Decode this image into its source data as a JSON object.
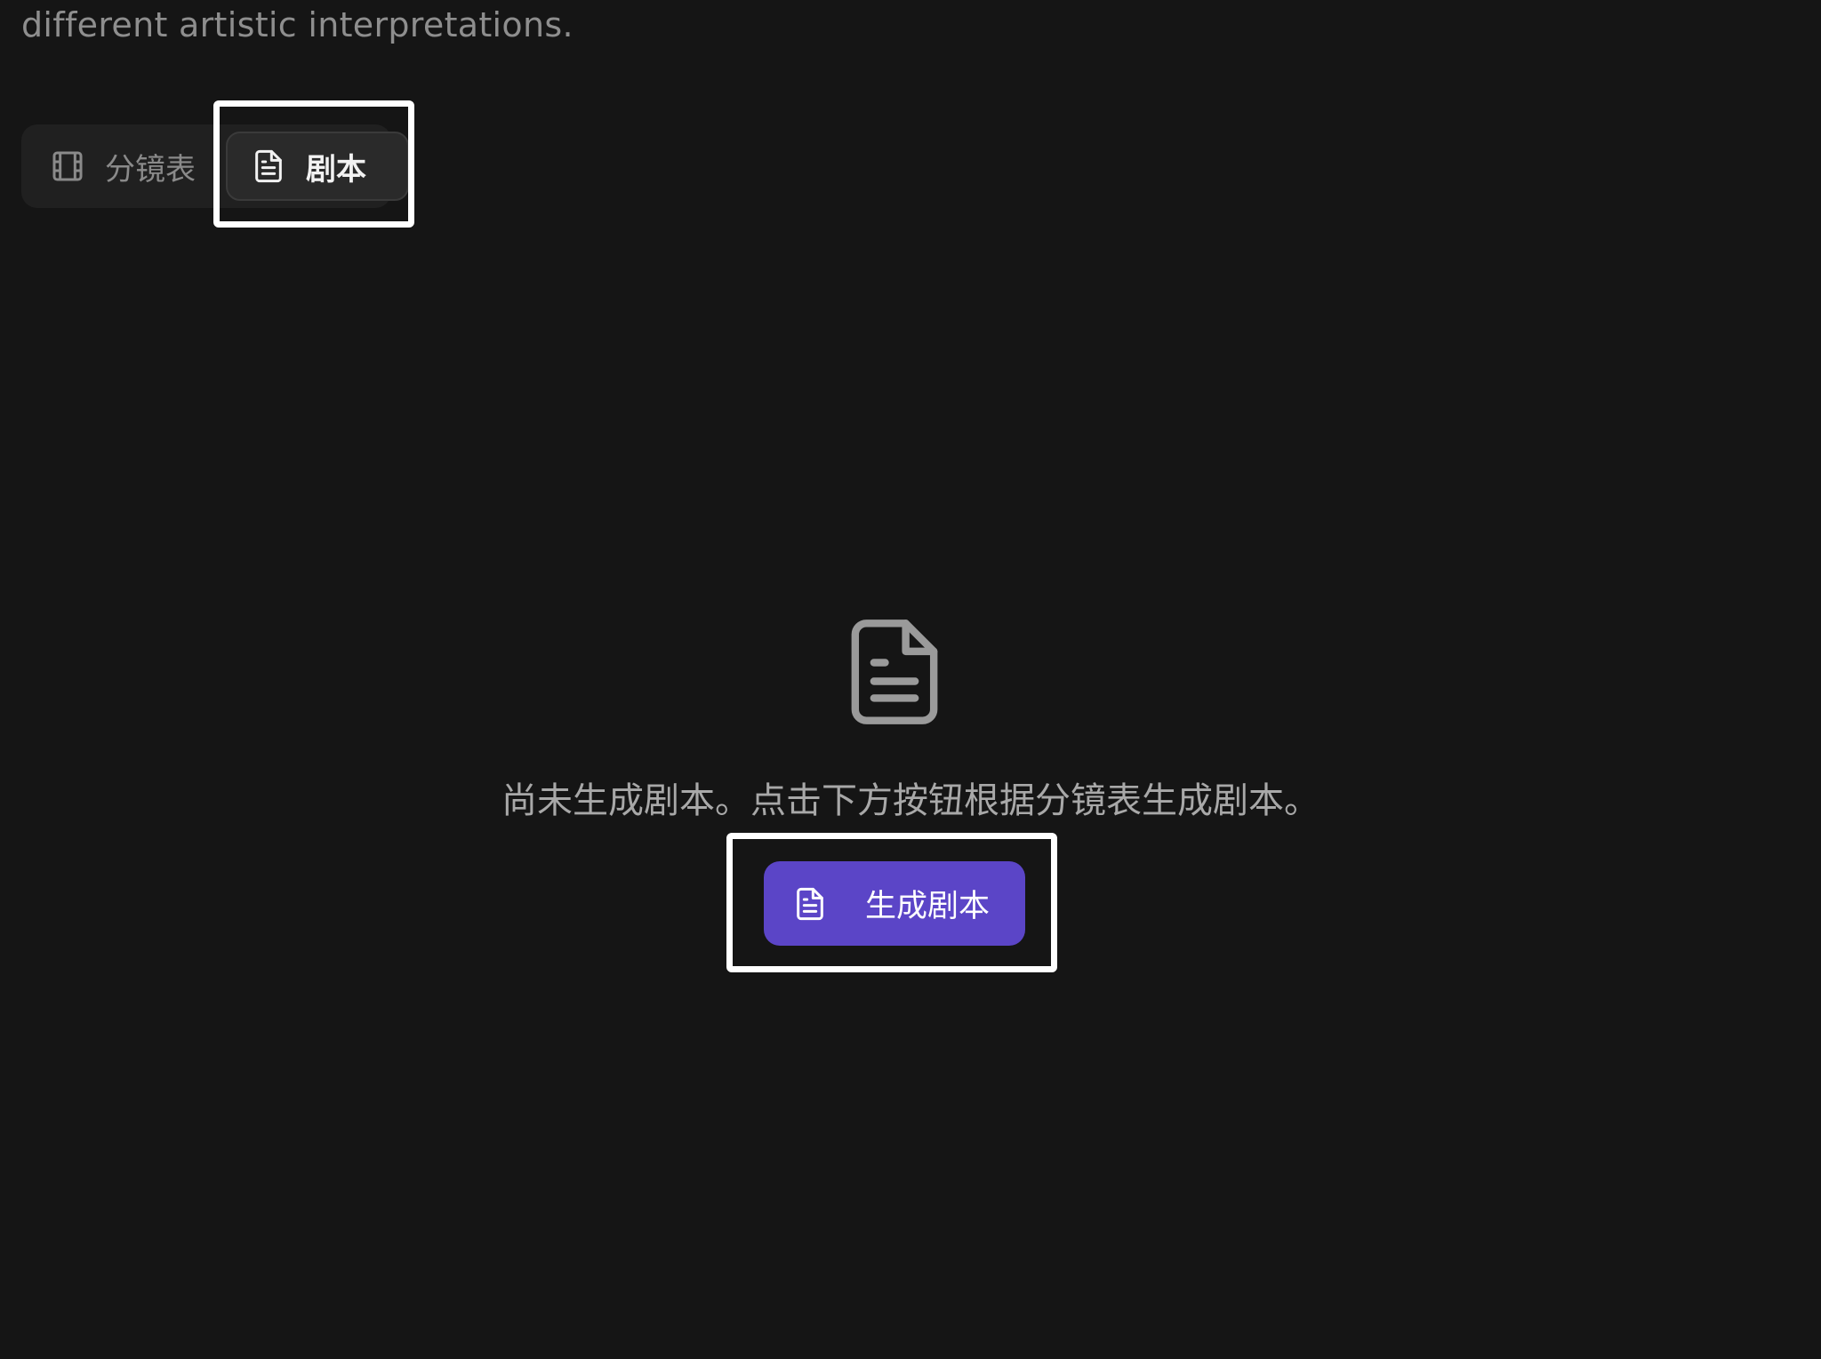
{
  "header": {
    "description_tail": "different artistic interpretations."
  },
  "tabs": [
    {
      "label": "分镜表",
      "icon": "film-icon",
      "selected": false
    },
    {
      "label": "剧本",
      "icon": "document-icon",
      "selected": true
    }
  ],
  "empty_state": {
    "icon": "document-icon",
    "message": "尚未生成剧本。点击下方按钮根据分镜表生成剧本。",
    "button_label": "生成剧本",
    "button_icon": "document-icon"
  },
  "colors": {
    "background": "#151515",
    "accent_button": "#5b45c7",
    "muted_text": "#8e8e8e",
    "highlight": "#ffffff"
  }
}
